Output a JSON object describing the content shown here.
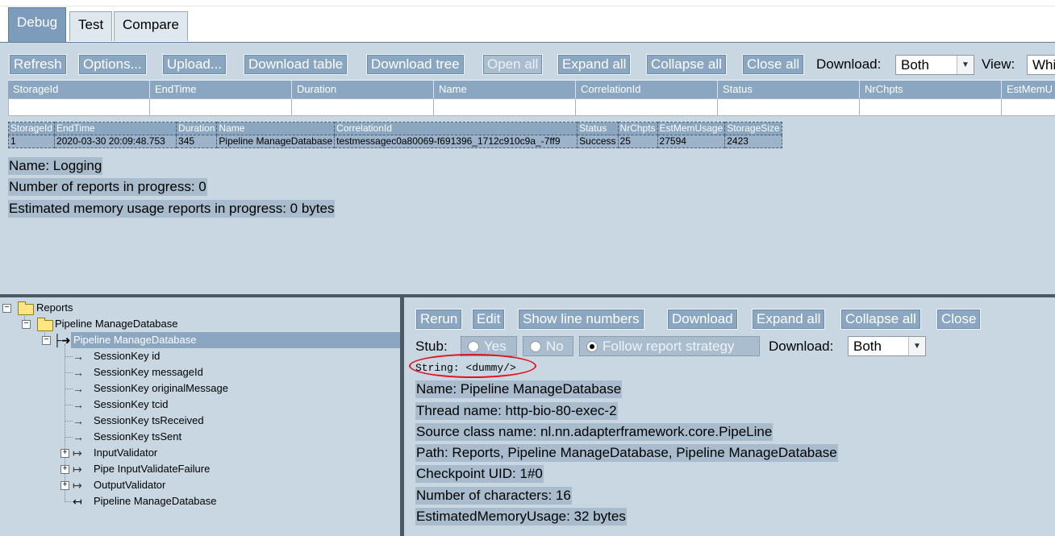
{
  "tabs": [
    {
      "label": "Debug"
    },
    {
      "label": "Test"
    },
    {
      "label": "Compare"
    }
  ],
  "toolbar": {
    "refresh": "Refresh",
    "options": "Options...",
    "upload": "Upload...",
    "download_table": "Download table",
    "download_tree": "Download tree",
    "open_all": "Open all",
    "expand_all": "Expand all",
    "collapse_all": "Collapse all",
    "close_all": "Close all",
    "download_label": "Download:",
    "download_value": "Both",
    "view_label": "View:",
    "view_value": "Whi"
  },
  "filter_headers": [
    "StorageId",
    "EndTime",
    "Duration",
    "Name",
    "CorrelationId",
    "Status",
    "NrChpts",
    "EstMemU"
  ],
  "results": {
    "headers": [
      "StorageId",
      "EndTime",
      "Duration",
      "Name",
      "CorrelationId",
      "Status",
      "NrChpts",
      "EstMemUsage",
      "StorageSize"
    ],
    "rows": [
      [
        "1",
        "2020-03-30 20:09:48.753",
        "345",
        "Pipeline ManageDatabase",
        "testmessagec0a80069-f691396_1712c910c9a_-7ff9",
        "Success",
        "25",
        "27594",
        "2423"
      ]
    ]
  },
  "info": {
    "name": "Name: Logging",
    "in_progress": "Number of reports in progress: 0",
    "memory": "Estimated memory usage reports in progress: 0 bytes"
  },
  "tree": {
    "root": "Reports",
    "report": "Pipeline ManageDatabase",
    "selected": "Pipeline ManageDatabase",
    "children": [
      "SessionKey id",
      "SessionKey messageId",
      "SessionKey originalMessage",
      "SessionKey tcid",
      "SessionKey tsReceived",
      "SessionKey tsSent",
      "InputValidator",
      "Pipe InputValidateFailure",
      "OutputValidator",
      "Pipeline ManageDatabase"
    ]
  },
  "detail_toolbar": {
    "rerun": "Rerun",
    "edit": "Edit",
    "show_line_numbers": "Show line numbers",
    "download": "Download",
    "expand_all": "Expand all",
    "collapse_all": "Collapse all",
    "close": "Close"
  },
  "stub": {
    "label": "Stub:",
    "yes": "Yes",
    "no": "No",
    "follow": "Follow report strategy",
    "download_label": "Download:",
    "download_value": "Both"
  },
  "message": "String: <dummy/>",
  "checkpoint_info": {
    "name": "Name: Pipeline ManageDatabase",
    "thread": "Thread name: http-bio-80-exec-2",
    "source": "Source class name: nl.nn.adapterframework.core.PipeLine",
    "path": "Path: Reports, Pipeline ManageDatabase, Pipeline ManageDatabase",
    "uid": "Checkpoint UID: 1#0",
    "chars": "Number of characters: 16",
    "memory": "EstimatedMemoryUsage: 32 bytes"
  },
  "colors": {
    "pane_bg": "#c9d7e3",
    "button_bg": "#8aa6c1",
    "annotation": "#e0141e"
  }
}
